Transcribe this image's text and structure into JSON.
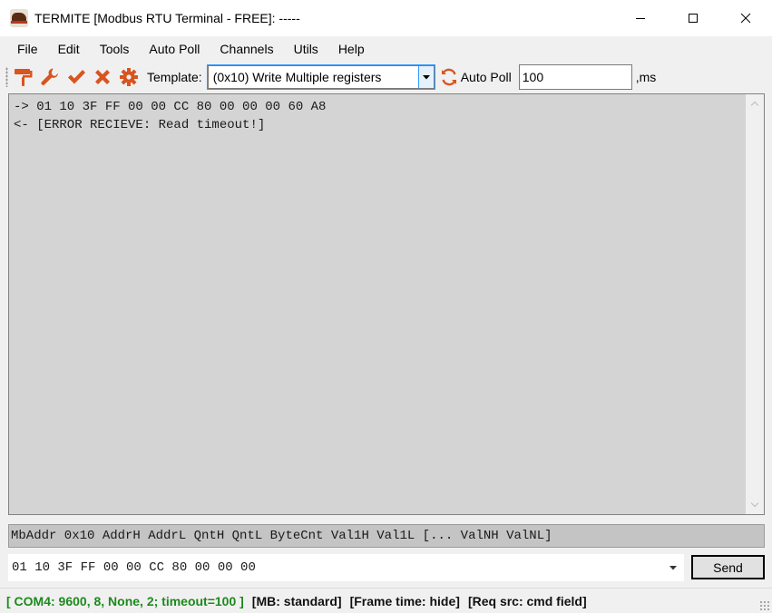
{
  "window": {
    "title": "TERMITE [Modbus RTU Terminal - FREE]: -----",
    "controls": [
      "minimize-icon",
      "maximize-icon",
      "close-icon"
    ]
  },
  "menu": [
    "File",
    "Edit",
    "Tools",
    "Auto Poll",
    "Channels",
    "Utils",
    "Help"
  ],
  "toolbar": {
    "icons": [
      "paint-roller-icon",
      "wrench-icon",
      "checkmark-icon",
      "cross-icon",
      "gear-icon"
    ],
    "template_label": "Template:",
    "template_value": "(0x10) Write Multiple registers",
    "refresh_icon": "refresh-icon",
    "autopoll_label": "Auto Poll",
    "poll_value": "100",
    "ms_label": ",ms"
  },
  "terminal": {
    "lines": [
      "-> 01 10 3F FF 00 00 CC 80 00 00 00 60 A8",
      "<- [ERROR RECIEVE: Read timeout!]"
    ]
  },
  "hint": "MbAddr 0x10 AddrH AddrL QntH QntL ByteCnt Val1H Val1L [... ValNH ValNL]",
  "command": {
    "value": "01 10 3F FF 00 00 CC 80 00 00 00",
    "send_label": "Send"
  },
  "status": {
    "com": "[ COM4: 9600, 8, None, 2; timeout=100 ]",
    "mb": "[MB: standard]",
    "frame": "[Frame time: hide]",
    "req": "[Req src: cmd field]"
  },
  "colors": {
    "status_com": "#1c8a1c",
    "toolbar_icon": "#d9541e",
    "terminal_bg": "#d4d4d4",
    "focus": "#3399ff"
  }
}
